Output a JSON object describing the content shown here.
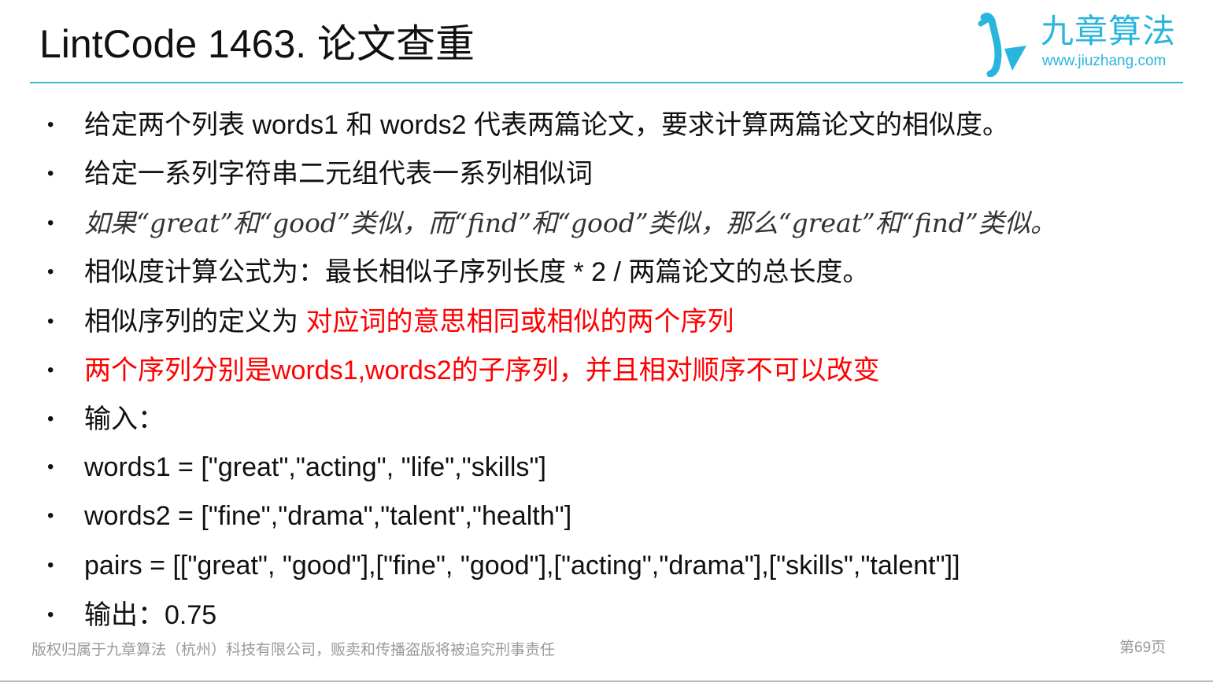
{
  "slide": {
    "title": "LintCode 1463. 论文查重"
  },
  "logo": {
    "brand_cn": "九章算法",
    "url": "www.jiuzhang.com",
    "icon": "jiuzhang-logo-icon",
    "accent_color": "#29b6dc"
  },
  "bullets": [
    {
      "text": "给定两个列表 words1 和 words2 代表两篇论文，要求计算两篇论文的相似度。"
    },
    {
      "text": "给定一系列字符串二元组代表一系列相似词"
    },
    {
      "text": "如果“great”和“good”类似，而“find”和“good”类似，那么“great”和“find”类似。"
    },
    {
      "text": "相似度计算公式为：最长相似子序列长度 * 2 / 两篇论文的总长度。"
    },
    {
      "prefix": "相似序列的定义为 ",
      "highlight": "对应词的意思相同或相似的两个序列"
    },
    {
      "text": "两个序列分别是words1,words2的子序列，并且相对顺序不可以改变"
    },
    {
      "text": "输入："
    },
    {
      "text": "words1 = [\"great\",\"acting\", \"life\",\"skills\"]"
    },
    {
      "text": "words2 = [\"fine\",\"drama\",\"talent\",\"health\"]"
    },
    {
      "text": "pairs = [[\"great\", \"good\"],[\"fine\", \"good\"],[\"acting\",\"drama\"],[\"skills\",\"talent\"]]"
    },
    {
      "text": "输出：0.75"
    }
  ],
  "bullet_marker": "•",
  "footer": {
    "copyright": "版权归属于九章算法（杭州）科技有限公司，贩卖和传播盗版将被追究刑事责任",
    "page_number": "第69页"
  },
  "colors": {
    "text": "#111111",
    "highlight": "#ff0000",
    "rule": "#35b8d8",
    "footer": "#9a9a9a"
  }
}
